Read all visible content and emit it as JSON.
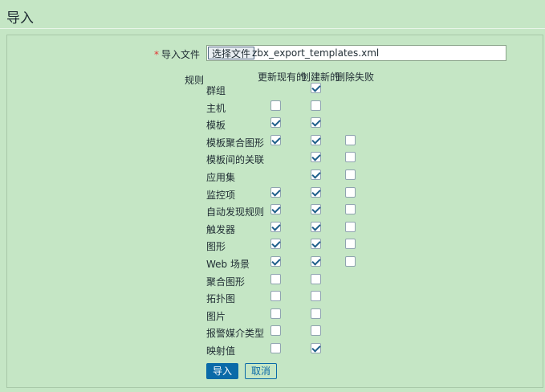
{
  "page": {
    "title": "导入"
  },
  "file": {
    "required_mark": "*",
    "label": "导入文件",
    "choose_button": "选择文件",
    "file_name": "zbx_export_templates.xml"
  },
  "rules": {
    "label": "规则",
    "columns": [
      "更新现有的",
      "创建新的",
      "删除失败"
    ],
    "items": [
      {
        "name": "群组",
        "update": null,
        "create": true,
        "delete": null
      },
      {
        "name": "主机",
        "update": false,
        "create": false,
        "delete": null
      },
      {
        "name": "模板",
        "update": true,
        "create": true,
        "delete": null
      },
      {
        "name": "模板聚合图形",
        "update": true,
        "create": true,
        "delete": false
      },
      {
        "name": "模板间的关联",
        "update": null,
        "create": true,
        "delete": false
      },
      {
        "name": "应用集",
        "update": null,
        "create": true,
        "delete": false
      },
      {
        "name": "监控项",
        "update": true,
        "create": true,
        "delete": false
      },
      {
        "name": "自动发现规则",
        "update": true,
        "create": true,
        "delete": false
      },
      {
        "name": "触发器",
        "update": true,
        "create": true,
        "delete": false
      },
      {
        "name": "图形",
        "update": true,
        "create": true,
        "delete": false
      },
      {
        "name": "Web 场景",
        "update": true,
        "create": true,
        "delete": false
      },
      {
        "name": "聚合图形",
        "update": false,
        "create": false,
        "delete": null
      },
      {
        "name": "拓扑图",
        "update": false,
        "create": false,
        "delete": null
      },
      {
        "name": "图片",
        "update": false,
        "create": false,
        "delete": null
      },
      {
        "name": "报警媒介类型",
        "update": false,
        "create": false,
        "delete": null
      },
      {
        "name": "映射值",
        "update": false,
        "create": true,
        "delete": null
      }
    ]
  },
  "buttons": {
    "import": "导入",
    "cancel": "取消"
  },
  "colors": {
    "background": "#c5e6c5",
    "primary": "#0a6aa8",
    "required": "#e33734"
  }
}
